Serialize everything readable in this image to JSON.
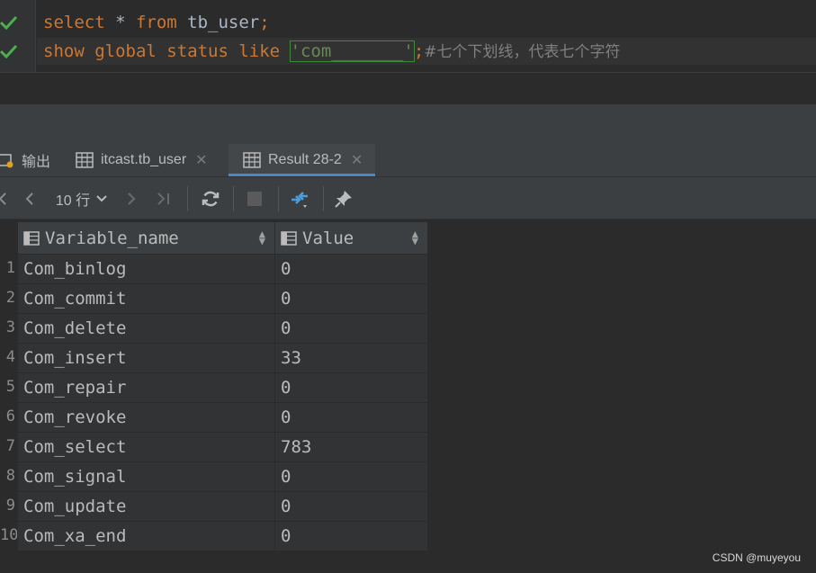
{
  "editor": {
    "line1": {
      "kw1": "select",
      "rest1": " * ",
      "kw2": "from",
      "rest2": " tb_user",
      "semi": ";"
    },
    "line2": {
      "kw": "show global status like",
      "space": " ",
      "string": "'com_______'",
      "semi": ";",
      "comment": "#七个下划线，代表七个字符"
    }
  },
  "tabs": [
    {
      "label": "输出",
      "icon": "output-icon"
    },
    {
      "label": "itcast.tb_user",
      "icon": "table-icon",
      "close": "✕"
    },
    {
      "label": "Result 28-2",
      "icon": "table-icon",
      "close": "✕",
      "active": true
    }
  ],
  "toolbar": {
    "rows_label": "10 行"
  },
  "grid": {
    "columns": [
      "Variable_name",
      "Value"
    ],
    "row_numbers": [
      "1",
      "2",
      "3",
      "4",
      "5",
      "6",
      "7",
      "8",
      "9",
      "10"
    ],
    "rows": [
      [
        "Com_binlog",
        "0"
      ],
      [
        "Com_commit",
        "0"
      ],
      [
        "Com_delete",
        "0"
      ],
      [
        "Com_insert",
        "33"
      ],
      [
        "Com_repair",
        "0"
      ],
      [
        "Com_revoke",
        "0"
      ],
      [
        "Com_select",
        "783"
      ],
      [
        "Com_signal",
        "0"
      ],
      [
        "Com_update",
        "0"
      ],
      [
        "Com_xa_end",
        "0"
      ]
    ]
  },
  "watermark": "CSDN @muyeyou",
  "colors": {
    "keyword": "#cc7832",
    "string": "#6a8759",
    "comment": "#808080",
    "check": "#4caf50",
    "accent": "#4a88c7"
  }
}
